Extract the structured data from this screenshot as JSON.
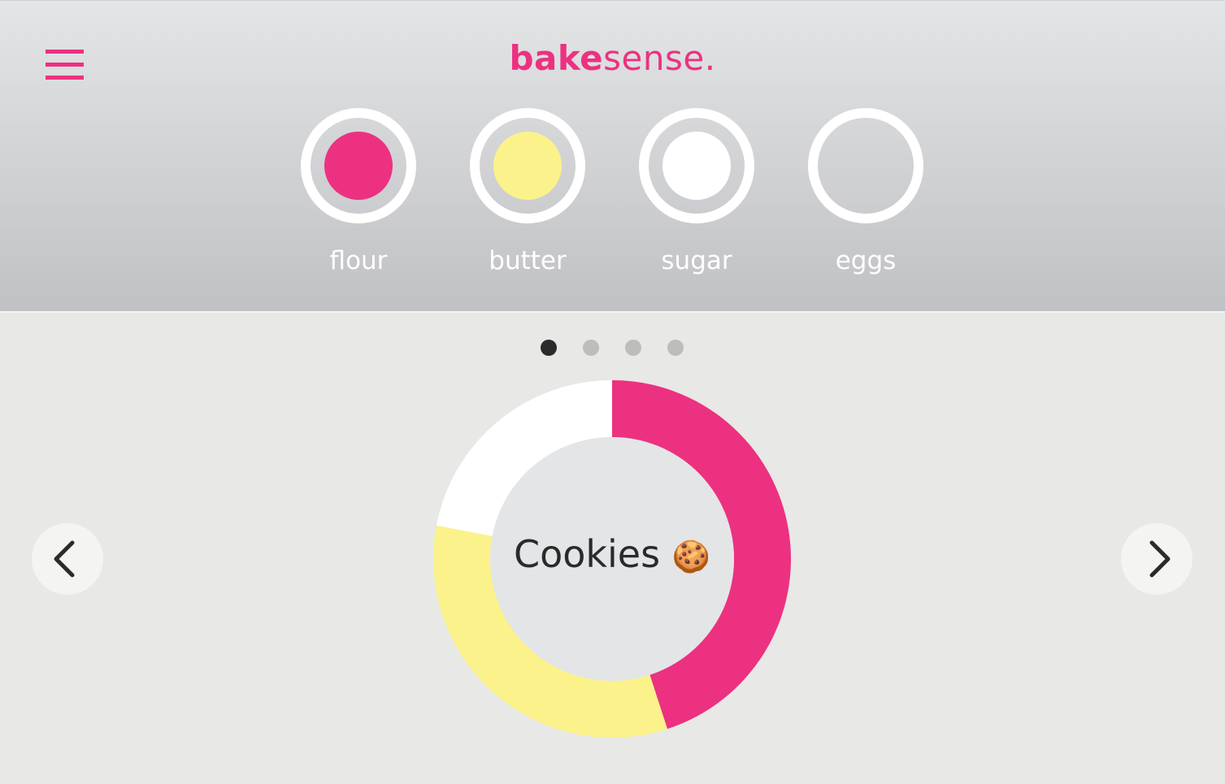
{
  "brand": {
    "part1": "bake",
    "part2": "sense."
  },
  "menu_icon": "hamburger-menu-icon",
  "ingredients": [
    {
      "label": "flour",
      "dot_color": "#ec3180",
      "filled": true
    },
    {
      "label": "butter",
      "dot_color": "#fbf28b",
      "filled": true
    },
    {
      "label": "sugar",
      "dot_color": "#ffffff",
      "filled": true
    },
    {
      "label": "eggs",
      "dot_color": null,
      "filled": false
    }
  ],
  "pager": {
    "total": 4,
    "active_index": 0
  },
  "nav": {
    "prev_icon": "chevron-left-icon",
    "next_icon": "chevron-right-icon"
  },
  "recipe": {
    "name": "Cookies",
    "emoji": "🍪"
  },
  "colors": {
    "accent": "#ec3180",
    "butter": "#fbf28b",
    "sugar": "#ffffff",
    "center": "#e4e5e7"
  },
  "chart_data": {
    "type": "pie",
    "style": "donut",
    "series": [
      {
        "name": "flour",
        "value": 45,
        "color": "#ec3180"
      },
      {
        "name": "butter",
        "value": 33,
        "color": "#fbf28b"
      },
      {
        "name": "sugar",
        "value": 22,
        "color": "#ffffff"
      }
    ]
  }
}
